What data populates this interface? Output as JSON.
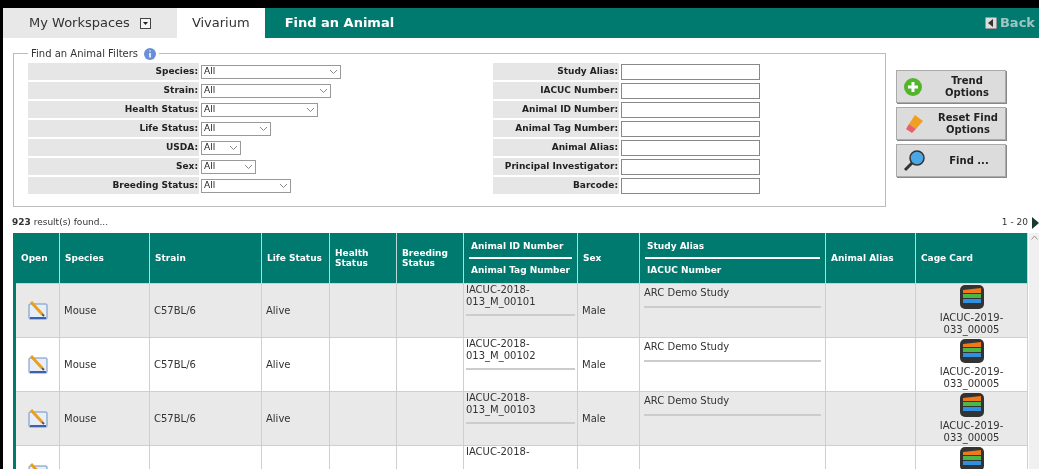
{
  "header": {
    "workspaces": "My Workspaces",
    "module": "Vivarium",
    "title": "Find an Animal",
    "back": "Back"
  },
  "filters": {
    "legend": "Find an Animal Filters",
    "selects": [
      {
        "label": "Species:",
        "value": "All"
      },
      {
        "label": "Strain:",
        "value": "All"
      },
      {
        "label": "Health Status:",
        "value": "All"
      },
      {
        "label": "Life Status:",
        "value": "All"
      },
      {
        "label": "USDA:",
        "value": "All"
      },
      {
        "label": "Sex:",
        "value": "All"
      },
      {
        "label": "Breeding Status:",
        "value": "All"
      }
    ],
    "fields": [
      {
        "label": "Study Alias:"
      },
      {
        "label": "IACUC Number:"
      },
      {
        "label": "Animal ID Number:"
      },
      {
        "label": "Animal Tag Number:"
      },
      {
        "label": "Animal Alias:"
      },
      {
        "label": "Principal Investigator:"
      },
      {
        "label": "Barcode:"
      }
    ]
  },
  "buttons": [
    {
      "kind": "add",
      "label": "Trend Options"
    },
    {
      "kind": "reset",
      "label": "Reset Find Options"
    },
    {
      "kind": "find",
      "label": "Find ..."
    }
  ],
  "results": {
    "count": "923",
    "text": "result(s) found...",
    "range": "1 - 20"
  },
  "columns": [
    {
      "label": "Open"
    },
    {
      "label": "Species"
    },
    {
      "label": "Strain"
    },
    {
      "label": "Life Status"
    },
    {
      "label": "Health Status"
    },
    {
      "label": "Breeding Status"
    },
    {
      "label": "Animal ID Number",
      "sublabel": "Animal Tag Number"
    },
    {
      "label": "Sex"
    },
    {
      "label": "Study Alias",
      "sublabel": "IACUC Number"
    },
    {
      "label": "Animal Alias"
    },
    {
      "label": "Cage Card"
    }
  ],
  "rows": [
    {
      "species": "Mouse",
      "strain": "C57BL/6",
      "life_status": "Alive",
      "animal_id": "IACUC-2018-013_M_00101",
      "sex": "Male",
      "study_alias": "ARC Demo Study",
      "cage_card": "IACUC-2019-033_00005"
    },
    {
      "species": "Mouse",
      "strain": "C57BL/6",
      "life_status": "Alive",
      "animal_id": "IACUC-2018-013_M_00102",
      "sex": "Male",
      "study_alias": "ARC Demo Study",
      "cage_card": "IACUC-2019-033_00005"
    },
    {
      "species": "Mouse",
      "strain": "C57BL/6",
      "life_status": "Alive",
      "animal_id": "IACUC-2018-013_M_00103",
      "sex": "Male",
      "study_alias": "ARC Demo Study",
      "cage_card": "IACUC-2019-033_00005"
    },
    {
      "animal_id": "IACUC-2018-"
    }
  ]
}
